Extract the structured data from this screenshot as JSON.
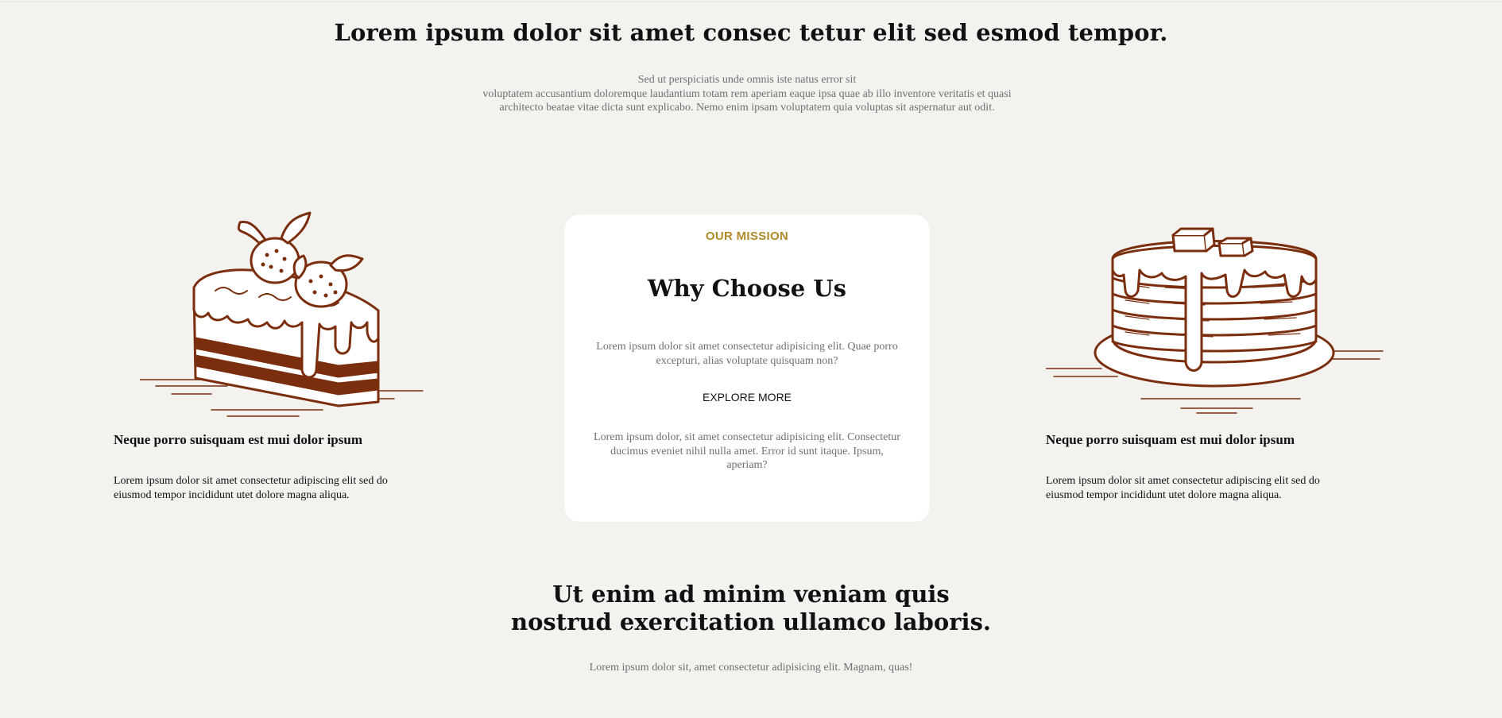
{
  "hero": {
    "title": "Lorem ipsum dolor sit amet consec tetur elit sed esmod tempor.",
    "subtitle_lines": [
      "Sed ut perspiciatis unde omnis iste natus error sit",
      "voluptatem accusantium doloremque laudantium totam rem aperiam eaque ipsa quae ab illo inventore veritatis et quasi",
      "architecto beatae vitae dicta sunt explicabo. Nemo enim ipsam voluptatem quia voluptas sit aspernatur aut odit."
    ]
  },
  "left_feature": {
    "icon": "cake-slice-illustration",
    "title": "Neque porro suisquam est mui dolor ipsum",
    "text_lines": [
      "Lorem ipsum dolor sit amet consectetur adipiscing elit sed do",
      "eiusmod tempor incididunt utet dolore magna aliqua."
    ]
  },
  "mission_card": {
    "eyebrow": "OUR MISSION",
    "title": "Why Choose Us",
    "paragraph1_lines": [
      "Lorem ipsum dolor sit amet consectetur adipisicing elit. Quae porro",
      "excepturi, alias voluptate quisquam non?"
    ],
    "link_label": "EXPLORE MORE",
    "paragraph2_lines": [
      "Lorem ipsum dolor, sit amet consectetur adipisicing elit. Consectetur",
      "ducimus eveniet nihil nulla amet. Error id sunt itaque. Ipsum,",
      "aperiam?"
    ]
  },
  "right_feature": {
    "icon": "pancake-stack-illustration",
    "title": "Neque porro suisquam est mui dolor ipsum",
    "text_lines": [
      "Lorem ipsum dolor sit amet consectetur adipiscing elit sed do",
      "eiusmod tempor incididunt utet dolore magna aliqua."
    ]
  },
  "closing": {
    "title_lines": [
      "Ut enim ad minim veniam quis",
      "nostrud exercitation ullamco laboris."
    ],
    "subtitle": "Lorem ipsum dolor sit, amet consectetur adipisicing elit. Magnam, quas!"
  },
  "colors": {
    "background": "#f4f2ef",
    "card": "#ffffff",
    "accent_gold": "#b08a2a",
    "illustration_brown": "#7a2e0e",
    "muted_text": "#707070"
  }
}
